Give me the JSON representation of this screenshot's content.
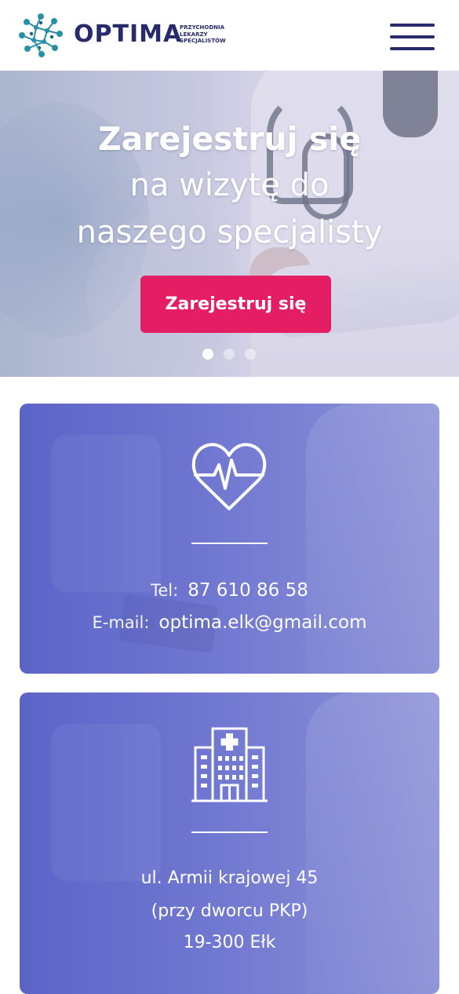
{
  "header": {
    "brand": "OPTIMA",
    "brand_sub": [
      "PRZYCHODNIA",
      "LEKARZY",
      "SPECJALISTÓW"
    ],
    "logo_icon": "molecule-logo-icon",
    "menu_icon": "hamburger-menu-icon"
  },
  "hero": {
    "title": "Zarejestruj się",
    "line1": "na wizytę do",
    "line2": "naszego specjalisty",
    "cta_label": "Zarejestruj się",
    "slides": 3,
    "active_slide": 1
  },
  "contact": {
    "icon": "heart-pulse-icon",
    "phone_label": "Tel:",
    "phone": "87 610 86 58",
    "email_label": "E-mail:",
    "email": "optima.elk@gmail.com"
  },
  "address": {
    "icon": "hospital-building-icon",
    "line1": "ul. Armii krajowej 45",
    "line2": "(przy dworcu PKP)",
    "line3": "19-300 Ełk"
  },
  "colors": {
    "brand_navy": "#272a6b",
    "cta_pink": "#e51d62",
    "card_purple": "#6f77d0",
    "logo_teal": "#2a8fa8"
  }
}
